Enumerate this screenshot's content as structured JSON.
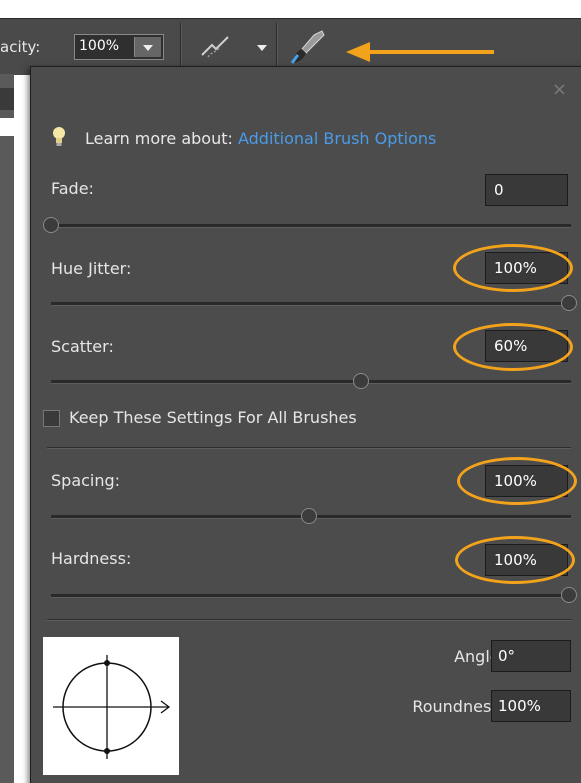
{
  "toolbar": {
    "opacity_label": "acity:",
    "opacity_value": "100%",
    "airbrush_icon": "airbrush-icon",
    "brush_icon": "brush-icon"
  },
  "panel": {
    "close": "×",
    "learn_prefix": "Learn more about:",
    "learn_link": "Additional Brush Options",
    "fade": {
      "label": "Fade:",
      "value": "0",
      "level": 0
    },
    "hue_jitter": {
      "label": "Hue Jitter:",
      "value": "100%",
      "level": 100
    },
    "scatter": {
      "label": "Scatter:",
      "value": "60%",
      "level": 60
    },
    "keep_settings": {
      "label": "Keep These Settings For All Brushes",
      "checked": false
    },
    "spacing": {
      "label": "Spacing:",
      "value": "100%",
      "level": 50
    },
    "hardness": {
      "label": "Hardness:",
      "value": "100%",
      "level": 100
    },
    "angle": {
      "label": "Angle:",
      "value": "0°"
    },
    "roundness": {
      "label": "Roundness:",
      "value": "100%"
    }
  },
  "annotation_color": "#f3a31b"
}
